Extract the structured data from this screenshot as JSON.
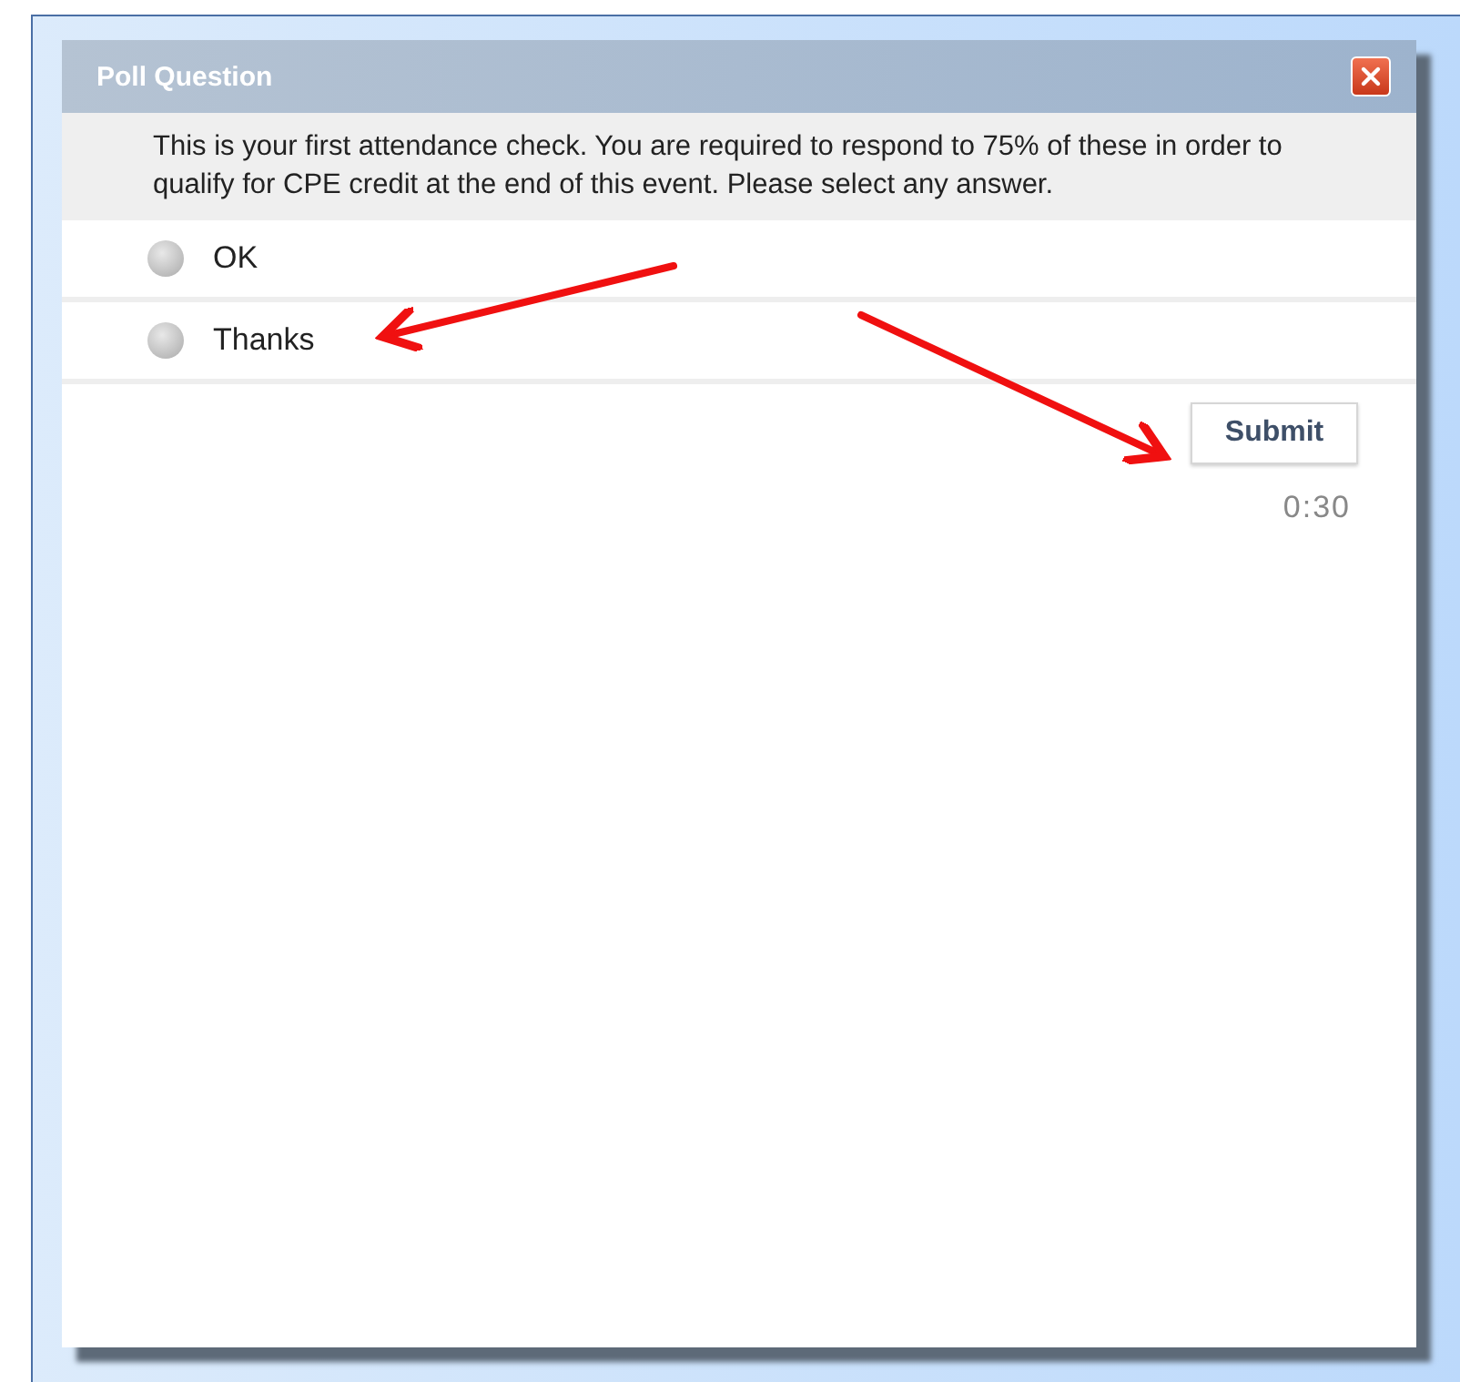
{
  "dialog": {
    "title": "Poll Question",
    "question": "This is your first attendance check. You are required to respond to 75% of these in order to qualify for CPE credit at the end of this event. Please select any answer.",
    "options": [
      {
        "label": "OK",
        "selected": false
      },
      {
        "label": "Thanks",
        "selected": false
      }
    ],
    "submit_button": "Submit",
    "timer": "0:30"
  }
}
